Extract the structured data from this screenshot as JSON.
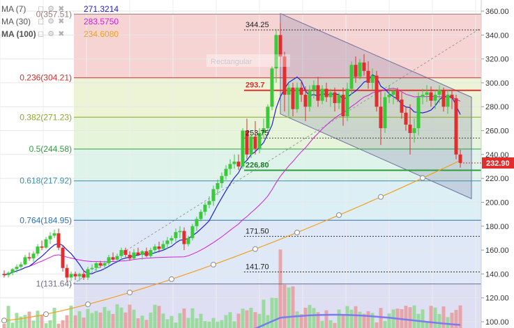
{
  "legend": {
    "ma7": {
      "name": "MA (7)",
      "value": "271.3214",
      "color": "#1f1fd6"
    },
    "ma30": {
      "name": "MA (30)",
      "value": "283.5750",
      "color": "#d11fd6"
    },
    "ma100": {
      "name": "MA (100)",
      "value": "234.6080",
      "color": "#f0a020"
    },
    "tool_icons": "◻ ⚙ ✖"
  },
  "chart_data": {
    "type": "candlestick",
    "ylim": [
      94,
      364
    ],
    "y_ticks": [
      "360.00",
      "340.00",
      "320.00",
      "300.00",
      "280.00",
      "260.00",
      "240.00",
      "220.00",
      "200.00",
      "180.00",
      "160.00",
      "140.00",
      "120.00",
      "100.00"
    ],
    "y_tick_values": [
      360,
      340,
      320,
      300,
      280,
      260,
      240,
      220,
      200,
      180,
      160,
      140,
      120,
      100
    ],
    "last_price": "232.90",
    "last_price_value": 232.9,
    "fib_levels": [
      {
        "label": "0(357.51)",
        "value": 357.51,
        "color": "#9a7a7a"
      },
      {
        "label": "0.236(304.21)",
        "value": 304.21,
        "color": "#cc2f2f"
      },
      {
        "label": "0.382(271.23)",
        "value": 271.23,
        "color": "#8aa82a"
      },
      {
        "label": "0.5(244.58)",
        "value": 244.58,
        "color": "#2e9b3e"
      },
      {
        "label": "0.618(217.92)",
        "value": 217.92,
        "color": "#3a8fa8"
      },
      {
        "label": "0.764(184.95)",
        "value": 184.95,
        "color": "#2f6fb0"
      },
      {
        "label": "1(131.64)",
        "value": 131.64,
        "color": "#6a6a8a"
      }
    ],
    "price_labels": [
      {
        "label": "344.25",
        "value": 344.25
      },
      {
        "label": "293.7",
        "value": 293.7
      },
      {
        "label": "253.75",
        "value": 253.75
      },
      {
        "label": "226.80",
        "value": 226.8
      },
      {
        "label": "171.50",
        "value": 171.5
      },
      {
        "label": "141.70",
        "value": 141.7
      }
    ],
    "watermark": "Rectangular",
    "candles": [
      [
        140,
        143,
        137,
        139
      ],
      [
        139,
        142,
        137,
        141
      ],
      [
        141,
        145,
        139,
        144
      ],
      [
        144,
        148,
        141,
        146
      ],
      [
        146,
        150,
        143,
        148
      ],
      [
        148,
        156,
        147,
        154
      ],
      [
        154,
        158,
        151,
        153
      ],
      [
        153,
        159,
        150,
        157
      ],
      [
        157,
        165,
        155,
        163
      ],
      [
        163,
        168,
        160,
        162
      ],
      [
        162,
        171,
        161,
        169
      ],
      [
        169,
        175,
        165,
        172
      ],
      [
        172,
        177,
        170,
        174
      ],
      [
        174,
        178,
        160,
        162
      ],
      [
        162,
        164,
        142,
        145
      ],
      [
        145,
        148,
        134,
        137
      ],
      [
        137,
        142,
        134,
        140
      ],
      [
        140,
        142,
        135,
        138
      ],
      [
        138,
        141,
        134,
        140
      ],
      [
        140,
        143,
        135,
        137
      ],
      [
        137,
        146,
        135,
        144
      ],
      [
        144,
        148,
        143,
        145
      ],
      [
        145,
        150,
        141,
        149
      ],
      [
        149,
        151,
        145,
        147
      ],
      [
        147,
        151,
        144,
        149
      ],
      [
        149,
        156,
        147,
        154
      ],
      [
        154,
        158,
        151,
        152
      ],
      [
        152,
        157,
        150,
        155
      ],
      [
        155,
        162,
        153,
        160
      ],
      [
        160,
        162,
        154,
        156
      ],
      [
        156,
        159,
        151,
        153
      ],
      [
        153,
        161,
        152,
        158
      ],
      [
        158,
        162,
        155,
        156
      ],
      [
        156,
        160,
        152,
        159
      ],
      [
        159,
        162,
        154,
        155
      ],
      [
        155,
        162,
        153,
        160
      ],
      [
        160,
        165,
        157,
        163
      ],
      [
        163,
        167,
        158,
        161
      ],
      [
        161,
        168,
        160,
        165
      ],
      [
        165,
        171,
        161,
        168
      ],
      [
        168,
        172,
        165,
        170
      ],
      [
        170,
        178,
        167,
        175
      ],
      [
        175,
        180,
        170,
        176
      ],
      [
        176,
        179,
        160,
        165
      ],
      [
        165,
        172,
        163,
        170
      ],
      [
        170,
        182,
        168,
        180
      ],
      [
        180,
        188,
        176,
        186
      ],
      [
        186,
        194,
        184,
        192
      ],
      [
        192,
        200,
        189,
        198
      ],
      [
        198,
        205,
        195,
        201
      ],
      [
        201,
        214,
        197,
        211
      ],
      [
        211,
        219,
        206,
        216
      ],
      [
        216,
        225,
        212,
        222
      ],
      [
        222,
        231,
        219,
        228
      ],
      [
        228,
        236,
        223,
        232
      ],
      [
        232,
        240,
        228,
        234
      ],
      [
        234,
        240,
        227,
        230
      ],
      [
        230,
        262,
        228,
        260
      ],
      [
        260,
        270,
        236,
        240
      ],
      [
        240,
        258,
        237,
        255
      ],
      [
        255,
        268,
        240,
        245
      ],
      [
        245,
        262,
        241,
        258
      ],
      [
        258,
        270,
        253,
        262
      ],
      [
        262,
        282,
        260,
        280
      ],
      [
        280,
        314,
        277,
        312
      ],
      [
        312,
        345,
        300,
        340
      ],
      [
        340,
        350,
        316,
        322
      ],
      [
        322,
        326,
        276,
        290
      ],
      [
        290,
        300,
        272,
        296
      ],
      [
        296,
        300,
        272,
        278
      ],
      [
        278,
        300,
        275,
        296
      ],
      [
        296,
        302,
        284,
        290
      ],
      [
        290,
        297,
        268,
        280
      ],
      [
        280,
        298,
        276,
        294
      ],
      [
        294,
        302,
        287,
        298
      ],
      [
        298,
        305,
        280,
        285
      ],
      [
        285,
        298,
        282,
        295
      ],
      [
        295,
        300,
        284,
        288
      ],
      [
        288,
        295,
        280,
        292
      ],
      [
        292,
        296,
        276,
        283
      ],
      [
        283,
        292,
        278,
        290
      ],
      [
        290,
        296,
        264,
        272
      ],
      [
        272,
        300,
        268,
        295
      ],
      [
        295,
        318,
        290,
        315
      ],
      [
        315,
        322,
        300,
        305
      ],
      [
        305,
        320,
        303,
        317
      ],
      [
        317,
        324,
        306,
        310
      ],
      [
        310,
        318,
        295,
        300
      ],
      [
        300,
        312,
        294,
        306
      ],
      [
        306,
        310,
        276,
        280
      ],
      [
        280,
        294,
        248,
        262
      ],
      [
        262,
        292,
        258,
        288
      ],
      [
        288,
        298,
        283,
        290
      ],
      [
        290,
        296,
        282,
        293
      ],
      [
        293,
        296,
        284,
        286
      ],
      [
        286,
        292,
        270,
        275
      ],
      [
        275,
        280,
        260,
        265
      ],
      [
        265,
        282,
        240,
        258
      ],
      [
        258,
        270,
        250,
        262
      ],
      [
        262,
        292,
        256,
        288
      ],
      [
        288,
        295,
        282,
        290
      ],
      [
        290,
        298,
        284,
        292
      ],
      [
        292,
        297,
        280,
        285
      ],
      [
        285,
        294,
        278,
        290
      ],
      [
        290,
        298,
        283,
        294
      ],
      [
        294,
        296,
        276,
        280
      ],
      [
        280,
        294,
        274,
        290
      ],
      [
        290,
        293,
        278,
        287
      ],
      [
        287,
        290,
        236,
        240
      ],
      [
        240,
        244,
        229,
        233
      ]
    ]
  }
}
